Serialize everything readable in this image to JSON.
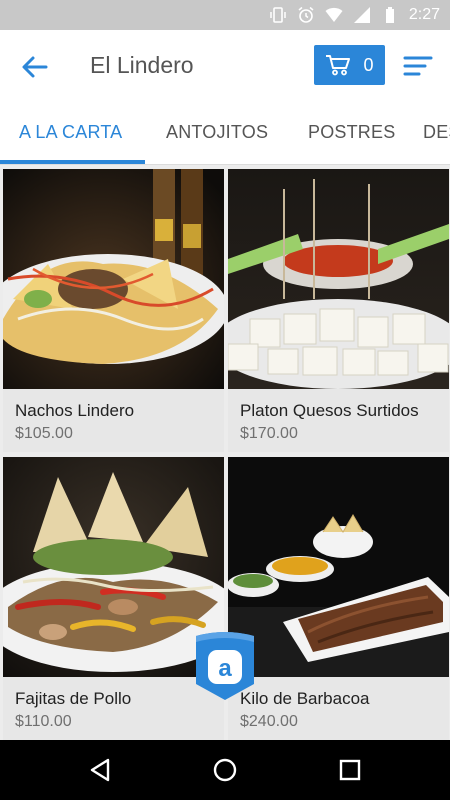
{
  "status_bar": {
    "time": "2:27",
    "icons": [
      "vibrate-icon",
      "alarm-icon",
      "wifi-icon",
      "signal-icon",
      "battery-icon"
    ]
  },
  "app_bar": {
    "title": "El Lindero",
    "cart_count": "0"
  },
  "tabs": [
    {
      "label": "A LA CARTA",
      "active": true
    },
    {
      "label": "ANTOJITOS",
      "active": false
    },
    {
      "label": "POSTRES",
      "active": false
    },
    {
      "label": "DES",
      "active": false
    }
  ],
  "products": [
    {
      "name": "Nachos Lindero",
      "price": "$105.00"
    },
    {
      "name": "Platon Quesos Surtidos",
      "price": "$170.00"
    },
    {
      "name": "Fajitas de Pollo",
      "price": "$110.00"
    },
    {
      "name": "Kilo de Barbacoa",
      "price": "$240.00"
    }
  ],
  "fab": {
    "letter": "a"
  },
  "colors": {
    "accent": "#2b86d8",
    "status_bar": "#c8c8c8",
    "card_bg": "#e7e7e7"
  }
}
